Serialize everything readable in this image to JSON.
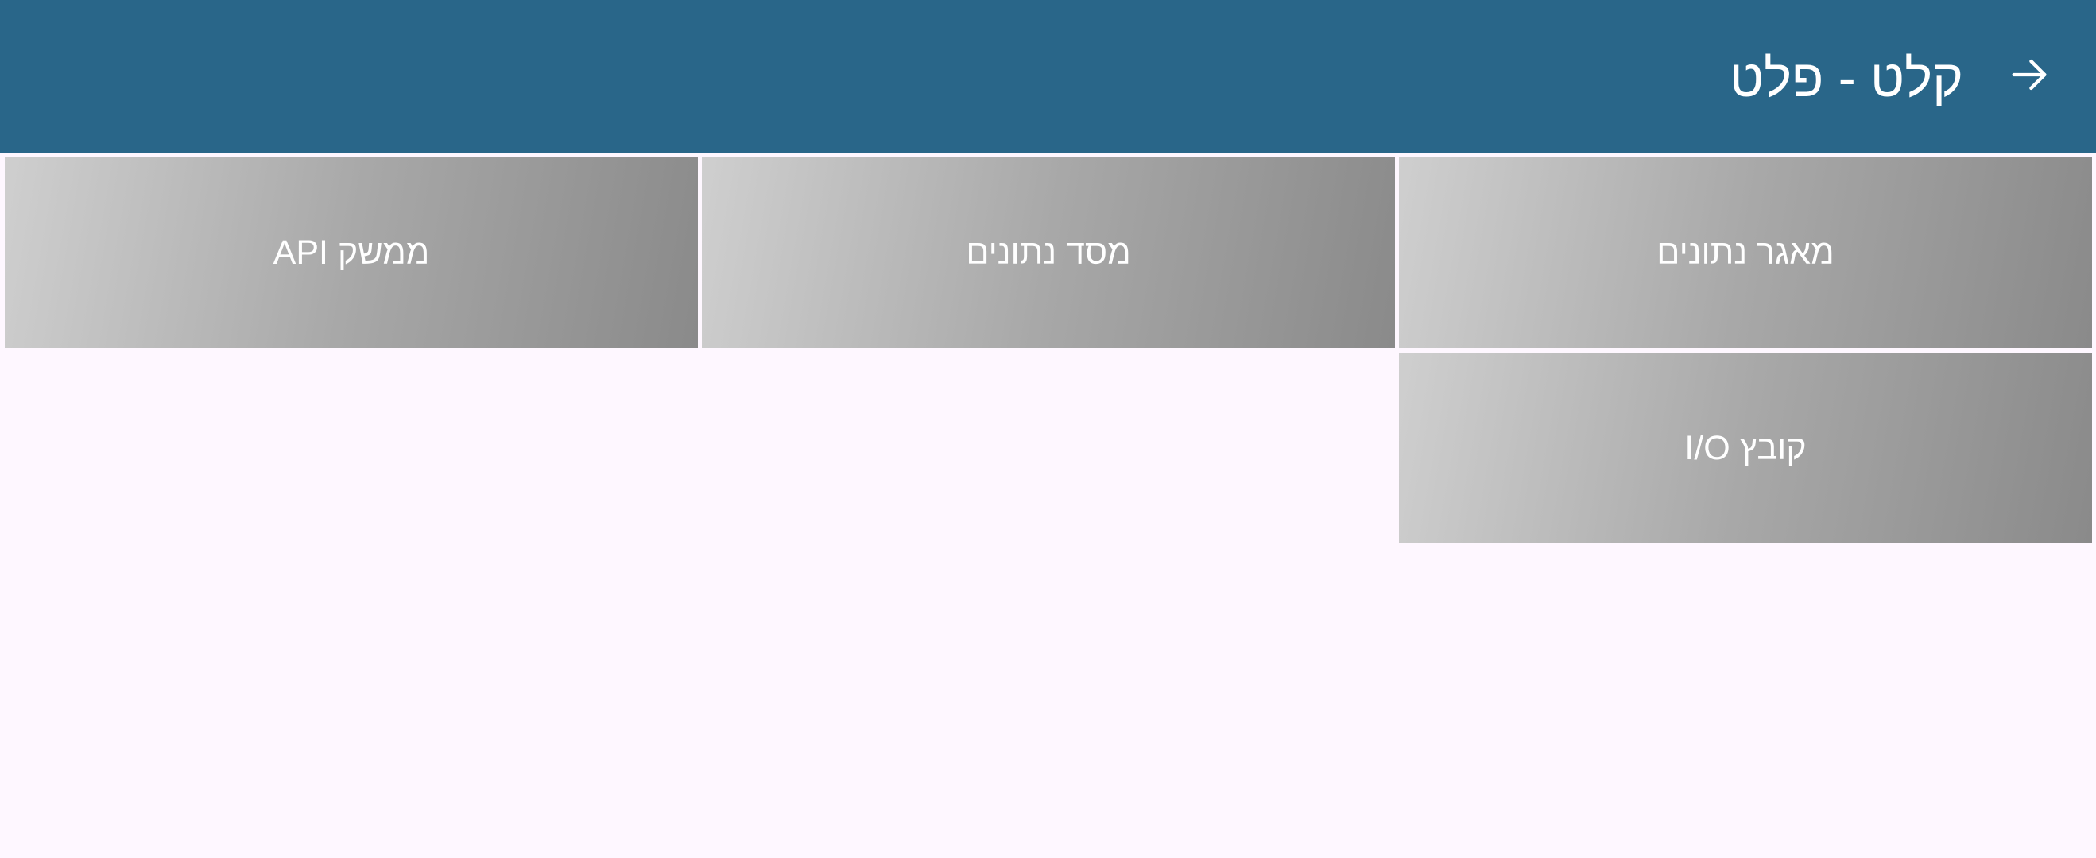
{
  "header": {
    "title": "קלט - פלט",
    "back_icon": "arrow-right-icon",
    "background_color": "#296689",
    "text_color": "#ffffff"
  },
  "tiles": [
    {
      "label": "מאגר נתונים"
    },
    {
      "label": "מסד נתונים"
    },
    {
      "label": "ממשק API"
    },
    {
      "label": "קובץ I/O"
    }
  ],
  "theme": {
    "page_background": "#fef7ff",
    "tile_gradient": [
      "#cfcfcf",
      "#8a8a8a"
    ]
  }
}
